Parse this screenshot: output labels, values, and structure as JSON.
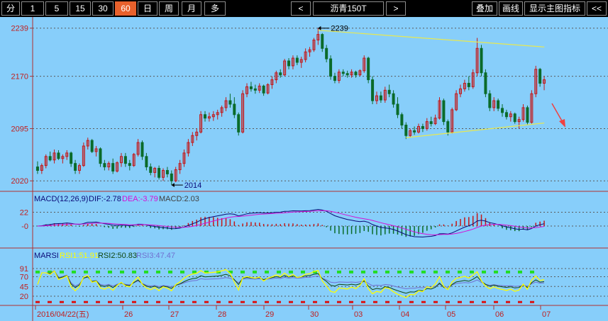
{
  "toolbar": {
    "periods": [
      {
        "label": "分",
        "active": false
      },
      {
        "label": "1",
        "active": false
      },
      {
        "label": "5",
        "active": false
      },
      {
        "label": "15",
        "active": false
      },
      {
        "label": "30",
        "active": false
      },
      {
        "label": "60",
        "active": true
      },
      {
        "label": "日",
        "active": false
      },
      {
        "label": "周",
        "active": false
      },
      {
        "label": "月",
        "active": false
      },
      {
        "label": "多",
        "active": false
      }
    ],
    "prev_label": "<",
    "symbol": "沥青150T",
    "next_label": ">",
    "overlay_label": "叠加",
    "draw_label": "画线",
    "show_indicator_label": "显示主图指标",
    "collapse_label": "<<"
  },
  "colors": {
    "background": "#87CEFA",
    "up": "#c41818",
    "down": "#0a6b2a",
    "dif": "#0a0a78",
    "dea": "#d60fd6",
    "rsi1": "#ffff00",
    "rsi2": "#10470f",
    "rsi3": "#7070d0",
    "trendline": "#e8e850",
    "overbought": "#22dd22",
    "oversold": "#dd1111"
  },
  "main_chart": {
    "y_ticks": [
      "2239",
      "2170",
      "2095",
      "2020"
    ],
    "high_marker": "2239",
    "low_marker": "2014"
  },
  "macd": {
    "title": "MACD(12,26,9)",
    "dif_label": "DIF:-2.78",
    "dea_label": "DEA:-3.79",
    "macd_label": "MACD:2.03",
    "y_ticks": [
      "22",
      "0"
    ]
  },
  "rsi": {
    "title": "MARSI",
    "rsi1_label": "RSI1:51.91",
    "rsi2_label": "RSI2:50.83",
    "rsi3_label": "RSI3:47.47",
    "y_ticks": [
      "91",
      "70",
      "45",
      "20"
    ]
  },
  "time_axis": [
    "2016/04/22(五)",
    "26",
    "27",
    "28",
    "29",
    "30",
    "03",
    "04",
    "05",
    "06",
    "07"
  ],
  "chart_data": {
    "type": "candlestick",
    "ylim": [
      2005,
      2255
    ],
    "candles": [
      [
        2040,
        2048,
        2030,
        2035
      ],
      [
        2035,
        2045,
        2030,
        2042
      ],
      [
        2042,
        2058,
        2038,
        2055
      ],
      [
        2055,
        2062,
        2048,
        2050
      ],
      [
        2050,
        2065,
        2045,
        2060
      ],
      [
        2060,
        2064,
        2050,
        2052
      ],
      [
        2052,
        2058,
        2045,
        2055
      ],
      [
        2055,
        2064,
        2050,
        2060
      ],
      [
        2060,
        2062,
        2040,
        2045
      ],
      [
        2045,
        2050,
        2030,
        2035
      ],
      [
        2035,
        2045,
        2030,
        2042
      ],
      [
        2042,
        2075,
        2040,
        2070
      ],
      [
        2070,
        2082,
        2065,
        2078
      ],
      [
        2078,
        2080,
        2060,
        2062
      ],
      [
        2062,
        2070,
        2055,
        2066
      ],
      [
        2066,
        2068,
        2040,
        2045
      ],
      [
        2045,
        2050,
        2035,
        2040
      ],
      [
        2040,
        2048,
        2035,
        2045
      ],
      [
        2045,
        2052,
        2030,
        2034
      ],
      [
        2034,
        2048,
        2032,
        2046
      ],
      [
        2046,
        2060,
        2040,
        2055
      ],
      [
        2055,
        2060,
        2040,
        2045
      ],
      [
        2045,
        2050,
        2035,
        2042
      ],
      [
        2042,
        2060,
        2040,
        2058
      ],
      [
        2058,
        2080,
        2055,
        2075
      ],
      [
        2075,
        2078,
        2050,
        2055
      ],
      [
        2055,
        2060,
        2035,
        2040
      ],
      [
        2040,
        2045,
        2028,
        2032
      ],
      [
        2032,
        2040,
        2025,
        2038
      ],
      [
        2038,
        2042,
        2022,
        2025
      ],
      [
        2025,
        2038,
        2020,
        2035
      ],
      [
        2035,
        2040,
        2025,
        2030
      ],
      [
        2030,
        2035,
        2014,
        2020
      ],
      [
        2020,
        2040,
        2018,
        2036
      ],
      [
        2036,
        2050,
        2030,
        2045
      ],
      [
        2045,
        2065,
        2040,
        2060
      ],
      [
        2060,
        2080,
        2055,
        2075
      ],
      [
        2075,
        2090,
        2070,
        2085
      ],
      [
        2085,
        2095,
        2078,
        2090
      ],
      [
        2090,
        2120,
        2088,
        2115
      ],
      [
        2115,
        2120,
        2105,
        2110
      ],
      [
        2110,
        2118,
        2105,
        2112
      ],
      [
        2112,
        2120,
        2106,
        2115
      ],
      [
        2115,
        2122,
        2108,
        2118
      ],
      [
        2118,
        2128,
        2112,
        2125
      ],
      [
        2125,
        2140,
        2120,
        2135
      ],
      [
        2135,
        2145,
        2125,
        2130
      ],
      [
        2130,
        2140,
        2110,
        2115
      ],
      [
        2115,
        2118,
        2085,
        2090
      ],
      [
        2090,
        2150,
        2088,
        2145
      ],
      [
        2145,
        2160,
        2140,
        2155
      ],
      [
        2155,
        2162,
        2148,
        2152
      ],
      [
        2152,
        2158,
        2145,
        2150
      ],
      [
        2150,
        2160,
        2146,
        2156
      ],
      [
        2156,
        2158,
        2142,
        2146
      ],
      [
        2146,
        2160,
        2144,
        2158
      ],
      [
        2158,
        2170,
        2152,
        2165
      ],
      [
        2165,
        2178,
        2160,
        2175
      ],
      [
        2175,
        2180,
        2168,
        2172
      ],
      [
        2172,
        2195,
        2170,
        2192
      ],
      [
        2192,
        2196,
        2180,
        2185
      ],
      [
        2185,
        2200,
        2180,
        2196
      ],
      [
        2196,
        2200,
        2186,
        2190
      ],
      [
        2190,
        2198,
        2182,
        2194
      ],
      [
        2194,
        2210,
        2190,
        2205
      ],
      [
        2205,
        2212,
        2198,
        2208
      ],
      [
        2208,
        2225,
        2205,
        2222
      ],
      [
        2222,
        2239,
        2215,
        2230
      ],
      [
        2230,
        2232,
        2205,
        2210
      ],
      [
        2210,
        2215,
        2190,
        2195
      ],
      [
        2195,
        2200,
        2165,
        2170
      ],
      [
        2170,
        2175,
        2160,
        2164
      ],
      [
        2164,
        2180,
        2160,
        2176
      ],
      [
        2176,
        2180,
        2170,
        2174
      ],
      [
        2174,
        2178,
        2168,
        2172
      ],
      [
        2172,
        2180,
        2168,
        2176
      ],
      [
        2176,
        2178,
        2168,
        2172
      ],
      [
        2172,
        2180,
        2170,
        2178
      ],
      [
        2178,
        2200,
        2175,
        2196
      ],
      [
        2196,
        2198,
        2160,
        2165
      ],
      [
        2165,
        2170,
        2130,
        2135
      ],
      [
        2135,
        2148,
        2130,
        2142
      ],
      [
        2142,
        2148,
        2132,
        2136
      ],
      [
        2136,
        2155,
        2132,
        2150
      ],
      [
        2150,
        2158,
        2140,
        2145
      ],
      [
        2145,
        2150,
        2125,
        2130
      ],
      [
        2130,
        2140,
        2110,
        2115
      ],
      [
        2115,
        2118,
        2095,
        2100
      ],
      [
        2100,
        2104,
        2080,
        2085
      ],
      [
        2085,
        2095,
        2082,
        2092
      ],
      [
        2092,
        2098,
        2086,
        2090
      ],
      [
        2090,
        2102,
        2088,
        2098
      ],
      [
        2098,
        2102,
        2090,
        2095
      ],
      [
        2095,
        2110,
        2092,
        2105
      ],
      [
        2105,
        2112,
        2098,
        2102
      ],
      [
        2102,
        2115,
        2100,
        2110
      ],
      [
        2110,
        2140,
        2108,
        2135
      ],
      [
        2135,
        2138,
        2100,
        2105
      ],
      [
        2105,
        2108,
        2085,
        2090
      ],
      [
        2090,
        2125,
        2088,
        2122
      ],
      [
        2122,
        2150,
        2120,
        2145
      ],
      [
        2145,
        2158,
        2140,
        2152
      ],
      [
        2152,
        2165,
        2148,
        2160
      ],
      [
        2160,
        2170,
        2150,
        2155
      ],
      [
        2155,
        2180,
        2152,
        2175
      ],
      [
        2175,
        2225,
        2170,
        2210
      ],
      [
        2210,
        2215,
        2170,
        2175
      ],
      [
        2175,
        2180,
        2140,
        2145
      ],
      [
        2145,
        2150,
        2120,
        2125
      ],
      [
        2125,
        2140,
        2120,
        2135
      ],
      [
        2135,
        2138,
        2120,
        2124
      ],
      [
        2124,
        2130,
        2112,
        2118
      ],
      [
        2118,
        2122,
        2108,
        2112
      ],
      [
        2112,
        2120,
        2105,
        2116
      ],
      [
        2116,
        2118,
        2102,
        2105
      ],
      [
        2105,
        2112,
        2095,
        2108
      ],
      [
        2108,
        2130,
        2105,
        2125
      ],
      [
        2125,
        2128,
        2100,
        2104
      ],
      [
        2104,
        2150,
        2102,
        2145
      ],
      [
        2145,
        2185,
        2140,
        2180
      ],
      [
        2180,
        2182,
        2155,
        2160
      ],
      [
        2160,
        2170,
        2150,
        2165
      ]
    ]
  }
}
